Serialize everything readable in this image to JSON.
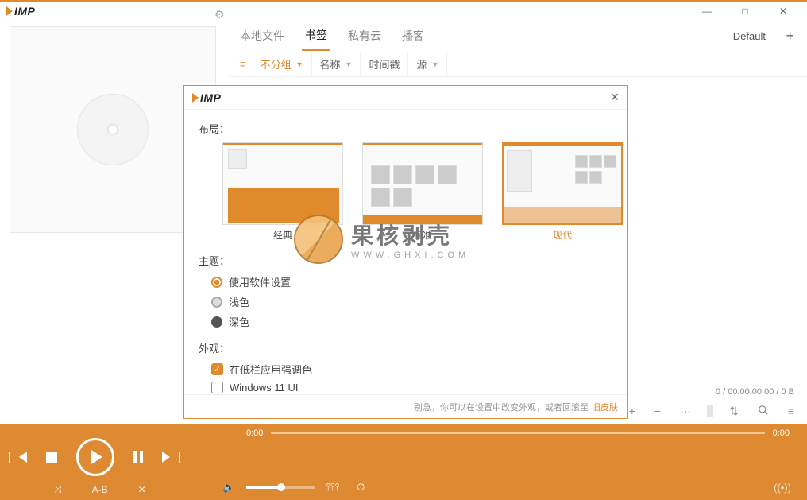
{
  "app_name": "IMP",
  "window": {
    "minimize": "—",
    "maximize": "□",
    "close": "✕"
  },
  "tabs": [
    {
      "label": "本地文件",
      "active": false
    },
    {
      "label": "书签",
      "active": true
    },
    {
      "label": "私有云",
      "active": false
    },
    {
      "label": "播客",
      "active": false
    }
  ],
  "default_label": "Default",
  "filters": {
    "group": "不分组",
    "name": "名称",
    "timestamp": "时间戳",
    "source": "源"
  },
  "status": "0 / 00:00:00:00 / 0 B",
  "toolbar_icons": {
    "add": "+",
    "remove": "−",
    "more": "···",
    "sort": "⇅",
    "search": "🔍",
    "menu": "≡"
  },
  "player": {
    "time_current": "0:00",
    "time_total": "0:00",
    "ab_label": "A-B"
  },
  "dialog": {
    "section_layout": "布局：",
    "layouts": [
      {
        "label": "经典",
        "selected": false
      },
      {
        "label": "标准",
        "selected": false
      },
      {
        "label": "现代",
        "selected": true
      }
    ],
    "section_theme": "主题：",
    "theme_options": [
      {
        "label": "使用软件设置",
        "checked": true
      },
      {
        "label": "浅色",
        "checked": false
      },
      {
        "label": "深色",
        "checked": false
      }
    ],
    "section_appearance": "外观：",
    "appearance_checks": [
      {
        "label": "在低栏应用强调色",
        "checked": true
      },
      {
        "label": "Windows 11 UI",
        "checked": false
      }
    ],
    "footer_text1": "别急，你可以在设置中改变外观，或者回滚至",
    "footer_link": "旧皮肤"
  },
  "watermark": {
    "name": "果核剥壳",
    "url": "WWW.GHXI.COM"
  }
}
